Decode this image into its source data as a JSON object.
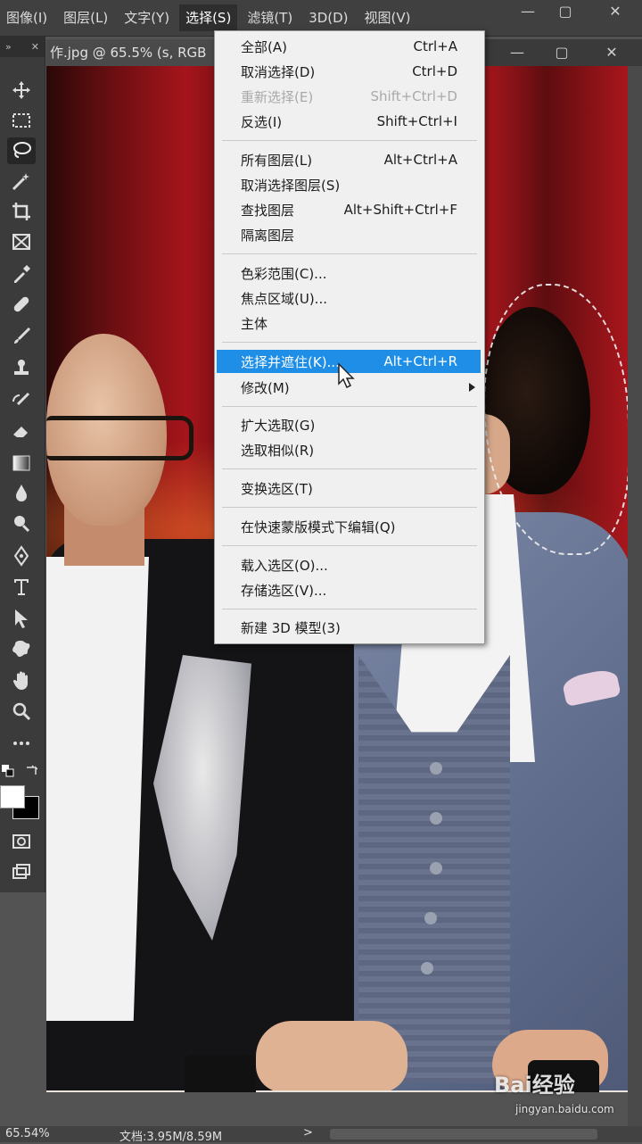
{
  "menubar": {
    "items": [
      {
        "label": "图像(I)"
      },
      {
        "label": "图层(L)"
      },
      {
        "label": "文字(Y)"
      },
      {
        "label": "选择(S)"
      },
      {
        "label": "滤镜(T)"
      },
      {
        "label": "3D(D)"
      },
      {
        "label": "视图(V)"
      }
    ],
    "minimize": "—",
    "maximize": "▢",
    "close": "✕"
  },
  "document_tab": {
    "label": "作.jpg @ 65.5% (s, RGB",
    "minimize": "—",
    "maximize": "▢",
    "close": "✕"
  },
  "toolbar": {
    "collapse": "»",
    "close": "✕"
  },
  "select_menu": {
    "groups": [
      [
        {
          "label": "全部(A)",
          "shortcut": "Ctrl+A"
        },
        {
          "label": "取消选择(D)",
          "shortcut": "Ctrl+D"
        },
        {
          "label": "重新选择(E)",
          "shortcut": "Shift+Ctrl+D"
        },
        {
          "label": "反选(I)",
          "shortcut": "Shift+Ctrl+I"
        }
      ],
      [
        {
          "label": "所有图层(L)",
          "shortcut": "Alt+Ctrl+A"
        },
        {
          "label": "取消选择图层(S)",
          "shortcut": ""
        },
        {
          "label": "查找图层",
          "shortcut": "Alt+Shift+Ctrl+F"
        },
        {
          "label": "隔离图层",
          "shortcut": ""
        }
      ],
      [
        {
          "label": "色彩范围(C)...",
          "shortcut": ""
        },
        {
          "label": "焦点区域(U)...",
          "shortcut": ""
        },
        {
          "label": "主体",
          "shortcut": ""
        }
      ],
      [
        {
          "label": "选择并遮住(K)...",
          "shortcut": "Alt+Ctrl+R"
        },
        {
          "label": "修改(M)",
          "shortcut": ""
        }
      ],
      [
        {
          "label": "扩大选取(G)",
          "shortcut": ""
        },
        {
          "label": "选取相似(R)",
          "shortcut": ""
        }
      ],
      [
        {
          "label": "变换选区(T)",
          "shortcut": ""
        }
      ],
      [
        {
          "label": "在快速蒙版模式下编辑(Q)",
          "shortcut": ""
        }
      ],
      [
        {
          "label": "载入选区(O)...",
          "shortcut": ""
        },
        {
          "label": "存储选区(V)...",
          "shortcut": ""
        }
      ],
      [
        {
          "label": "新建 3D 模型(3)",
          "shortcut": ""
        }
      ]
    ]
  },
  "statusbar": {
    "zoom": "65.54%",
    "doc_info": "文档:3.95M/8.59M",
    "arrow": ">"
  },
  "watermark": {
    "brand": "Bai经验",
    "url": "jingyan.baidu.com"
  },
  "colors": {
    "menu_highlight": "#1e8ee6",
    "chrome_dark": "#404040"
  }
}
